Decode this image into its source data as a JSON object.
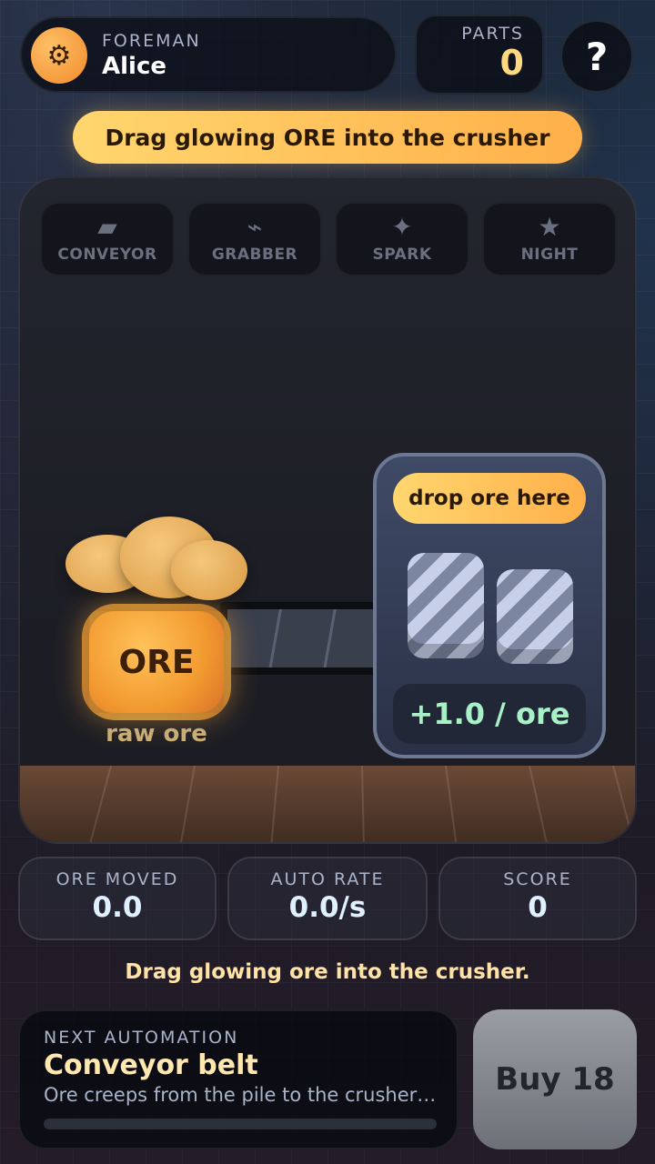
{
  "header": {
    "foreman_label": "FOREMAN",
    "foreman_name": "Alice",
    "avatar_icon": "gear-icon",
    "parts_label": "PARTS",
    "parts_value": "0",
    "help_label": "?"
  },
  "hint": "Drag glowing ORE into the crusher",
  "tabs": [
    {
      "label": "CONVEYOR",
      "icon": "conveyor-icon",
      "glyph": "▰"
    },
    {
      "label": "GRABBER",
      "icon": "grabber-icon",
      "glyph": "⌁"
    },
    {
      "label": "SPARK",
      "icon": "spark-icon",
      "glyph": "✦"
    },
    {
      "label": "NIGHT",
      "icon": "star-icon",
      "glyph": "★"
    }
  ],
  "stage": {
    "ore_label": "ORE",
    "ore_caption": "raw ore",
    "crusher_drop_label": "drop ore here",
    "crusher_rate": "+1.0 / ore"
  },
  "stats": [
    {
      "label": "ORE MOVED",
      "value": "0.0"
    },
    {
      "label": "AUTO RATE",
      "value": "0.0/s"
    },
    {
      "label": "SCORE",
      "value": "0"
    }
  ],
  "message": "Drag glowing ore into the crusher.",
  "automation": {
    "label": "NEXT AUTOMATION",
    "title": "Conveyor belt",
    "description": "Ore creeps from the pile to the crusher on its own.",
    "progress": 0
  },
  "buy_label": "Buy 18",
  "colors": {
    "accent": "#ffb04a",
    "ore": "#f29a2f",
    "rate": "#a8f0c6"
  }
}
